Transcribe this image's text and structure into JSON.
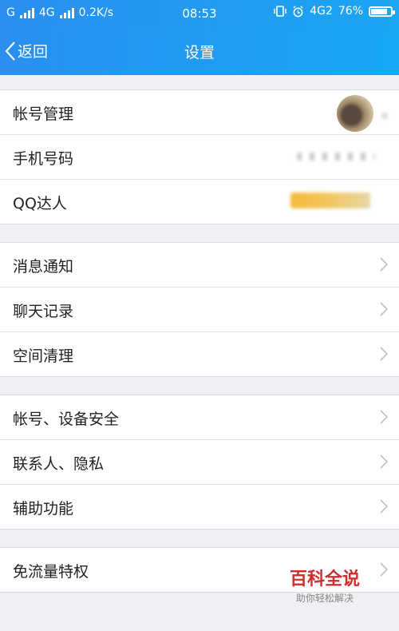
{
  "status_bar": {
    "network_left": "G",
    "network_4g_left": "4G",
    "speed": "0.2K/s",
    "time": "08:53",
    "network_right": "4G2",
    "battery": "76%"
  },
  "nav": {
    "back_label": "返回",
    "title": "设置"
  },
  "groups": [
    {
      "items": [
        {
          "label": "帐号管理"
        },
        {
          "label": "手机号码"
        },
        {
          "label": "QQ达人"
        }
      ]
    },
    {
      "items": [
        {
          "label": "消息通知"
        },
        {
          "label": "聊天记录"
        },
        {
          "label": "空间清理"
        }
      ]
    },
    {
      "items": [
        {
          "label": "帐号、设备安全"
        },
        {
          "label": "联系人、隐私"
        },
        {
          "label": "辅助功能"
        }
      ]
    },
    {
      "items": [
        {
          "label": "免流量特权"
        }
      ]
    }
  ],
  "watermark": {
    "main": "百科全说",
    "sub": "助你轻松解决"
  },
  "colors": {
    "nav_gradient_start": "#2a8ff0",
    "nav_gradient_end": "#17a8f4",
    "background": "#efeff4",
    "watermark": "#d22d2d"
  }
}
